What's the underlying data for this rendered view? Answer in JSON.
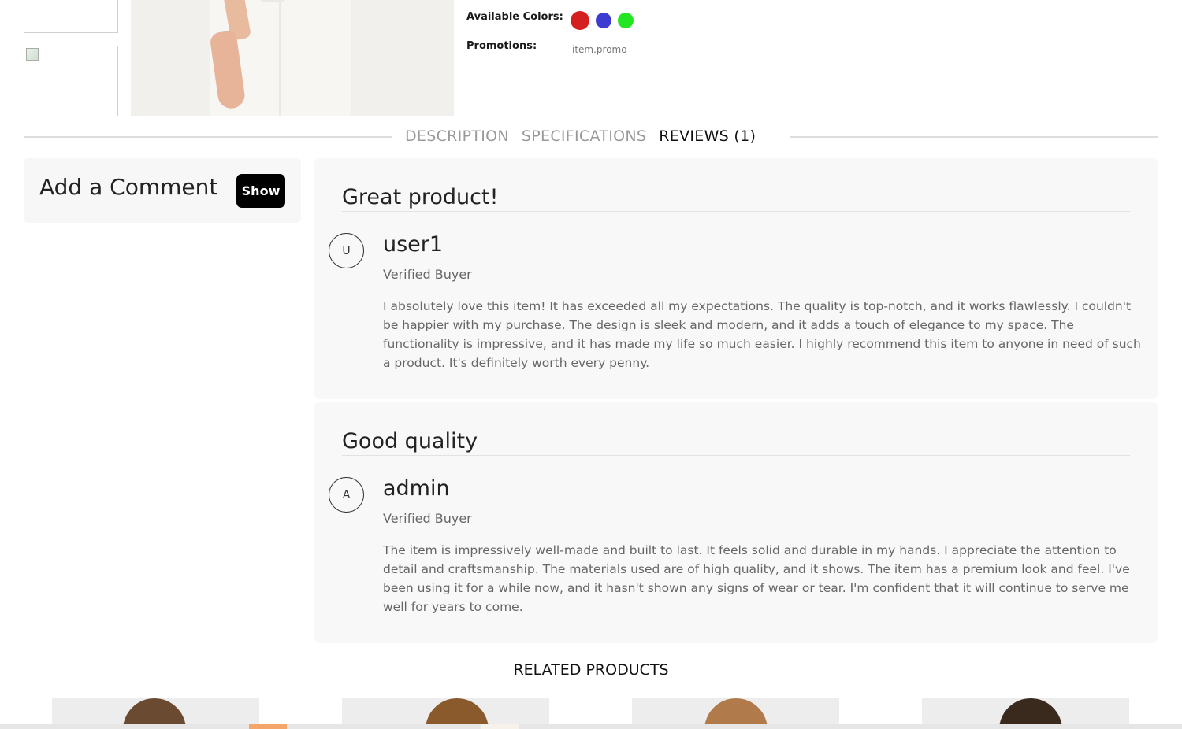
{
  "product": {
    "colors_label": "Available Colors:",
    "colors": [
      "#d42020",
      "#3c3cd0",
      "#22e622"
    ],
    "promotions_label": "Promotions:",
    "promotions_value": "item.promo"
  },
  "tabs": [
    {
      "label": "DESCRIPTION",
      "active": false
    },
    {
      "label": "SPECIFICATIONS",
      "active": false
    },
    {
      "label": "REVIEWS (1)",
      "active": true
    }
  ],
  "comment": {
    "title": "Add a Comment",
    "show_label": "Show"
  },
  "reviews": [
    {
      "title": "Great product!",
      "avatar_letter": "U",
      "user": "user1",
      "badge": "Verified Buyer",
      "text": "I absolutely love this item! It has exceeded all my expectations. The quality is top-notch, and it works flawlessly. I couldn't be happier with my purchase. The design is sleek and modern, and it adds a touch of elegance to my space. The functionality is impressive, and it has made my life so much easier. I highly recommend this item to anyone in need of such a product. It's definitely worth every penny."
    },
    {
      "title": "Good quality",
      "avatar_letter": "A",
      "user": "admin",
      "badge": "Verified Buyer",
      "text": "The item is impressively well-made and built to last. It feels solid and durable in my hands. I appreciate the attention to detail and craftsmanship. The materials used are of high quality, and it shows. The item has a premium look and feel. I've been using it for a while now, and it hasn't shown any signs of wear or tear. I'm confident that it will continue to serve me well for years to come."
    }
  ],
  "related": {
    "title": "RELATED PRODUCTS"
  }
}
